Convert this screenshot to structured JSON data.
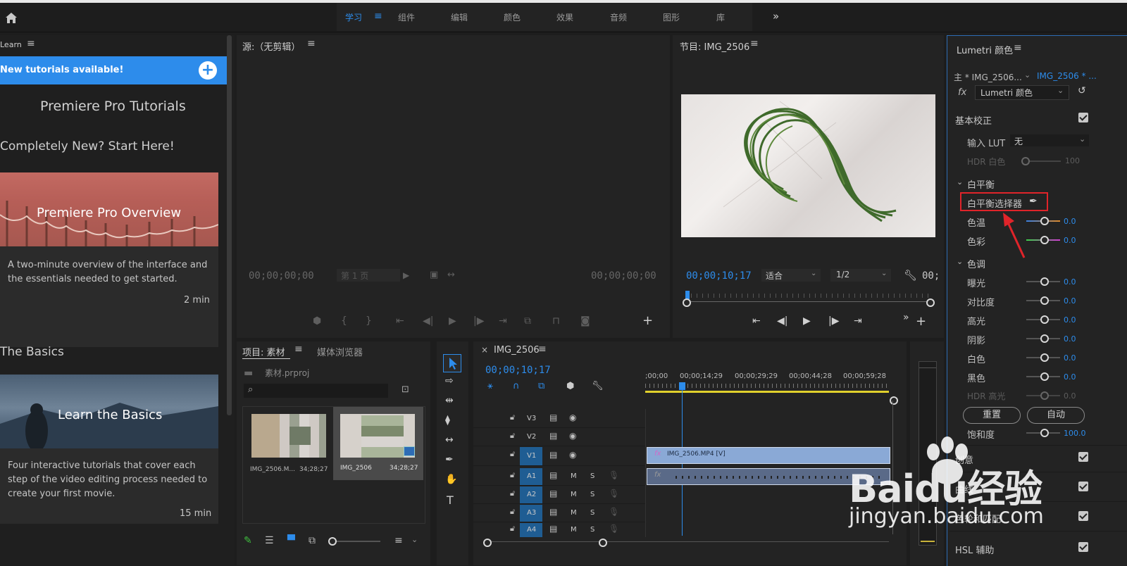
{
  "top_nav": {
    "items": [
      "学习",
      "组件",
      "编辑",
      "颜色",
      "效果",
      "音频",
      "图形",
      "库"
    ],
    "active_index": 0,
    "overflow": "»"
  },
  "learn": {
    "panel_title": "Learn",
    "banner": "New tutorials available!",
    "heading": "Premiere Pro Tutorials",
    "section1": "Completely New? Start Here!",
    "card1": {
      "title": "Premiere Pro Overview",
      "desc": "A two-minute overview of the interface and the essentials needed to get started.",
      "duration": "2 min"
    },
    "section2": "The Basics",
    "card2": {
      "title": "Learn the Basics",
      "desc": "Four interactive tutorials that cover each step of the video editing process needed to create your first movie.",
      "duration": "15 min"
    }
  },
  "source": {
    "title": "源:（无剪辑）",
    "timecode_left": "00;00;00;00",
    "page": "第 1 页",
    "timecode_right": "00;00;00;00"
  },
  "program": {
    "title": "节目: IMG_2506",
    "timecode": "00;00;10;17",
    "fit": "适合",
    "resolution": "1/2",
    "timecode_right": "00;"
  },
  "project": {
    "tab1": "项目: 素材",
    "tab2": "媒体浏览器",
    "file": "素材.prproj",
    "items": [
      {
        "name": "IMG_2506.M...",
        "duration": "34;28;27"
      },
      {
        "name": "IMG_2506",
        "duration": "34;28;27"
      }
    ]
  },
  "timeline": {
    "close": "×",
    "title": "IMG_2506",
    "timecode": "00;00;10;17",
    "ruler": [
      ";00;00",
      "00;00;14;29",
      "00;00;29;29",
      "00;00;44;28",
      "00;00;59;28"
    ],
    "tracks": [
      "V3",
      "V2",
      "V1",
      "A1",
      "A2",
      "A3",
      "A4"
    ],
    "clip_video": "IMG_2506.MP4 [V]",
    "m": "M",
    "s": "S",
    "fx": "fx",
    "cursor_fraction": 0.16
  },
  "lumetri": {
    "title": "Lumetri 颜色",
    "master": "主 * IMG_2506...",
    "seq": "IMG_2506 * ...",
    "fx_label": "fx",
    "effect_select": "Lumetri 颜色",
    "basic": "基本校正",
    "lut_label": "输入 LUT",
    "lut_value": "无",
    "hdr_white": "HDR 白色",
    "hdr_white_value": "100",
    "wb": "白平衡",
    "wb_picker": "白平衡选择器",
    "tone": "色调",
    "temp": {
      "label": "色温",
      "value": "0.0"
    },
    "tint": {
      "label": "色彩",
      "value": "0.0"
    },
    "sliders": [
      {
        "label": "曝光",
        "value": "0.0"
      },
      {
        "label": "对比度",
        "value": "0.0"
      },
      {
        "label": "高光",
        "value": "0.0"
      },
      {
        "label": "阴影",
        "value": "0.0"
      },
      {
        "label": "白色",
        "value": "0.0"
      },
      {
        "label": "黑色",
        "value": "0.0"
      },
      {
        "label": "HDR 高光",
        "value": "0.0"
      }
    ],
    "reset": "重置",
    "auto": "自动",
    "saturation": {
      "label": "饱和度",
      "value": "100.0"
    },
    "sections": [
      "创意",
      "曲线",
      "色轮和匹配",
      "HSL 辅助"
    ]
  },
  "watermark": {
    "brand": "Baidu经验",
    "url": "jingyan.baidu.com"
  },
  "colors": {
    "accent": "#2d8ceb",
    "banner": "#2d8ceb",
    "highlight_box": "#e0242a",
    "arrow": "#e0242a"
  }
}
